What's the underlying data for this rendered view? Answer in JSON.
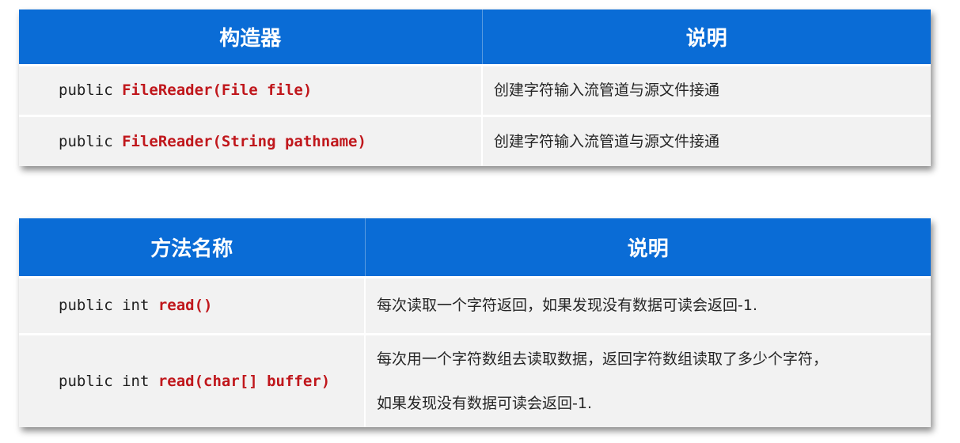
{
  "constructors_table": {
    "headers": [
      "构造器",
      "说明"
    ],
    "rows": [
      {
        "prefix": "public ",
        "highlight": "FileReader(File file)",
        "description": "创建字符输入流管道与源文件接通"
      },
      {
        "prefix": "public ",
        "highlight": "FileReader(String pathname)",
        "description": "创建字符输入流管道与源文件接通"
      }
    ]
  },
  "methods_table": {
    "headers": [
      "方法名称",
      "说明"
    ],
    "rows": [
      {
        "prefix": "public int ",
        "highlight": "read()",
        "description": "每次读取一个字符返回，如果发现没有数据可读会返回-1."
      },
      {
        "prefix": "public int ",
        "highlight": "read(char[] buffer)",
        "description_line1": "每次用一个字符数组去读取数据，返回字符数组读取了多少个字符，",
        "description_line2": "如果发现没有数据可读会返回-1."
      }
    ]
  },
  "colors": {
    "header_bg": "#0a6cd6",
    "row_bg": "#f2f2f2",
    "highlight": "#c0171c"
  }
}
